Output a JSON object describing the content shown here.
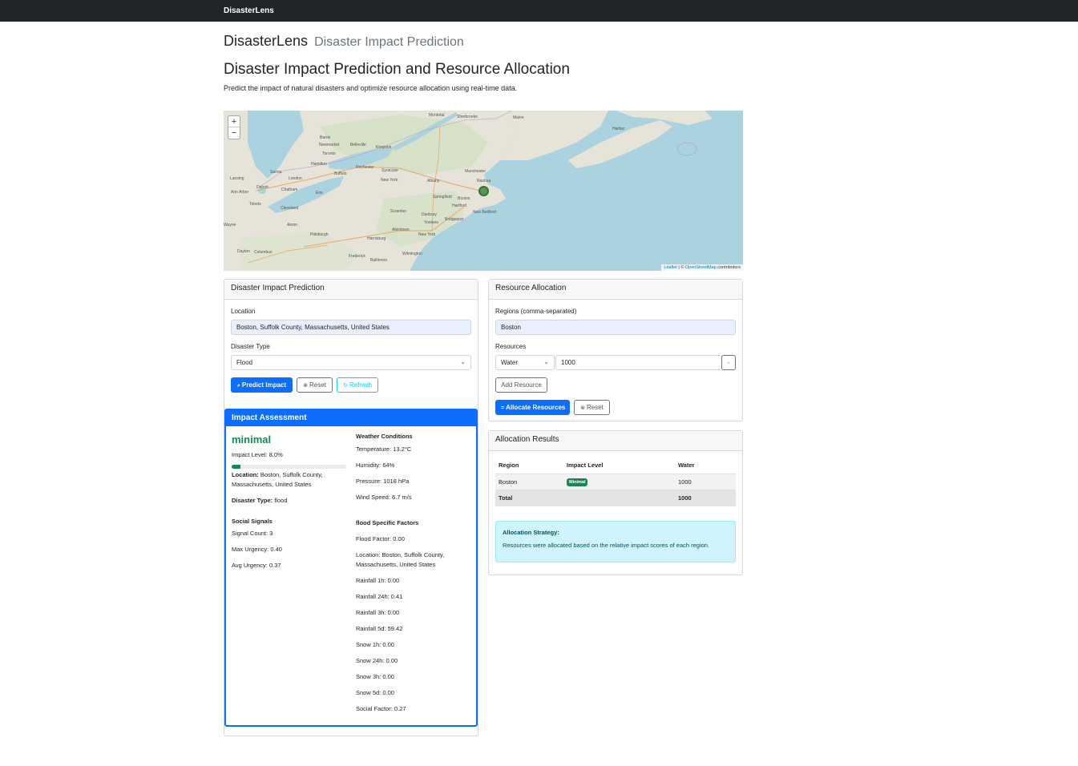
{
  "navbar": {
    "brand": "DisasterLens"
  },
  "header": {
    "app_name": "DisasterLens",
    "app_subtitle": "Disaster Impact Prediction",
    "title": "Disaster Impact Prediction and Resource Allocation",
    "description": "Predict the impact of natural disasters and optimize resource allocation using real-time data."
  },
  "map": {
    "zoom_in": "+",
    "zoom_out": "−",
    "attribution_leaflet": "Leaflet",
    "attribution_sep": " | © ",
    "attribution_osm": "OpenStreetMap",
    "attribution_suffix": " contributors",
    "cities": [
      "Montréal",
      "Sherbrooke",
      "Maine",
      "Halifax",
      "Barrie",
      "Newmarket",
      "Belleville",
      "Kingston",
      "Toronto",
      "Hamilton",
      "Buffalo",
      "Rochester",
      "Syracuse",
      "Manchester",
      "Sarnia",
      "London",
      "Albany",
      "Nashua",
      "Lansing",
      "Detroit",
      "Chatham",
      "Erie",
      "New York",
      "Springfield",
      "Boston",
      "Ann Arbor",
      "Toledo",
      "Cleveland",
      "Scranton",
      "Danbury",
      "Hartford",
      "New Bedford",
      "Bridgeport",
      "Akron",
      "Allentown",
      "Yonkers",
      "Wayne",
      "Pittsburgh",
      "New York",
      "Harrisburg",
      "Dayton",
      "Columbus",
      "Wilmington",
      "Frederick",
      "Baltimore"
    ]
  },
  "prediction": {
    "title": "Disaster Impact Prediction",
    "location_label": "Location",
    "location_value": "Boston, Suffolk County, Massachusetts, United States",
    "disaster_type_label": "Disaster Type",
    "disaster_type_value": "Flood",
    "predict_button": "Predict Impact",
    "reset_button": "Reset",
    "refresh_button": "Refresh"
  },
  "impact": {
    "title": "Impact Assessment",
    "level": "minimal",
    "impact_level_text": "Impact Level: 8.0%",
    "impact_fraction": 0.08,
    "location_label": "Location:",
    "location_value": " Boston, Suffolk County,",
    "location_value_2": "Massachusetts, United States",
    "disaster_type_label": "Disaster Type:",
    "disaster_type_value": " flood",
    "social_title": "Social Signals",
    "signal_count": "Signal Count: 3",
    "max_urgency": "Max Urgency: 0.40",
    "avg_urgency": "Avg Urgency: 0.37",
    "weather_title": "Weather Conditions",
    "temperature": "Temperature: 13.2°C",
    "humidity": "Humidity: 64%",
    "pressure": "Pressure: 1018 hPa",
    "wind_speed": "Wind Speed: 6.7 m/s",
    "factors_title": "flood Specific Factors",
    "factors": [
      "Flood Factor: 0.00",
      "Location: Boston, Suffolk County,",
      "Massachusetts, United States",
      "Rainfall 1h: 0.00",
      "Rainfall 24h: 0.41",
      "Rainfall 3h: 0.00",
      "Rainfall 5d: 59.42",
      "Snow 1h: 0.00",
      "Snow 24h: 0.00",
      "Snow 3h: 0.00",
      "Snow 5d: 0.00",
      "Social Factor: 0.27"
    ]
  },
  "allocation": {
    "title": "Resource Allocation",
    "regions_label": "Regions (comma-separated)",
    "regions_value": "Boston",
    "resources_label": "Resources",
    "resource_type": "Water",
    "resource_amount": "1000",
    "remove_button": "-",
    "add_resource_button": "Add Resource",
    "allocate_button": "Allocate Resources",
    "reset_button": "Reset"
  },
  "results": {
    "title": "Allocation Results",
    "columns": [
      "Region",
      "Impact Level",
      "Water"
    ],
    "rows": [
      {
        "region": "Boston",
        "impact": "Minimal",
        "water": "1000"
      }
    ],
    "total_label": "Total",
    "total_water": "1000",
    "strategy_title": "Allocation Strategy:",
    "strategy_text": "Resources were allocated based on the relative impact scores of each region."
  },
  "colors": {
    "primary": "#0d6efd",
    "success": "#198754",
    "info": "#0dcaf0",
    "navbar": "#212529"
  }
}
